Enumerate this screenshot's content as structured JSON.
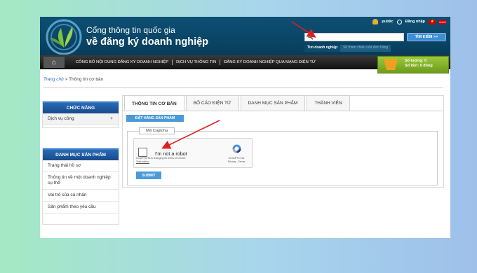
{
  "header": {
    "title_line1": "Cổng thông tin quốc gia",
    "title_line2": "về đăng ký doanh nghiệp",
    "user": "public",
    "login": "Đăng nhập",
    "search_button": "TÌM KIẾM >>",
    "search_value": "",
    "search_tabs": [
      "Tìm doanh nghiệp",
      "Số tham chiếu của đơn hàng"
    ]
  },
  "nav": {
    "items": [
      "CÔNG BỐ NỘI DUNG ĐĂNG KÝ DOANH NGHIỆP",
      "DỊCH VỤ THÔNG TIN",
      "ĐĂNG KÝ DOANH NGHIỆP QUA MẠNG ĐIỆN TỬ"
    ]
  },
  "cart": {
    "quantity": "Số lượng: 0",
    "money": "Số tiền: 0 đồng"
  },
  "breadcrumb": {
    "home": "Trang chủ",
    "sep": " > ",
    "current": "Thông tin cơ bản"
  },
  "sidebar": {
    "func_head": "CHỨC NĂNG",
    "func_item": "Dịch vụ công",
    "cat_head": "DANH MỤC SẢN PHẨM",
    "cat_items": [
      "Trạng thái hồ sơ",
      "Thông tin về một doanh nghiệp cụ thể",
      "Vai trò của cá nhân",
      "Sản phẩm theo yêu cầu"
    ]
  },
  "tabs": [
    "THÔNG TIN CƠ BẢN",
    "BỐ CÁO ĐIỆN TỬ",
    "DANH MỤC SẢN PHẨM",
    "THÀNH VIÊN"
  ],
  "main": {
    "order_button": "ĐẶT HÀNG SẢN PHẨM",
    "captcha_legend": "Mã Captcha",
    "recaptcha_label": "I'm not a robot",
    "recaptcha_brand": "reCAPTCHA",
    "recaptcha_privacy": "Privacy - Terms",
    "recaptcha_note": "reCAPTCHA is changing its terms of service.",
    "recaptcha_action": "Take action.",
    "submit_button": "SUBMIT"
  },
  "colors": {
    "header_bg": "#0a4566",
    "nav_bg": "#1a1a1a",
    "accent_blue": "#4a9ad8",
    "cart_green": "#8ab82a",
    "arrow_red": "#e02020"
  }
}
